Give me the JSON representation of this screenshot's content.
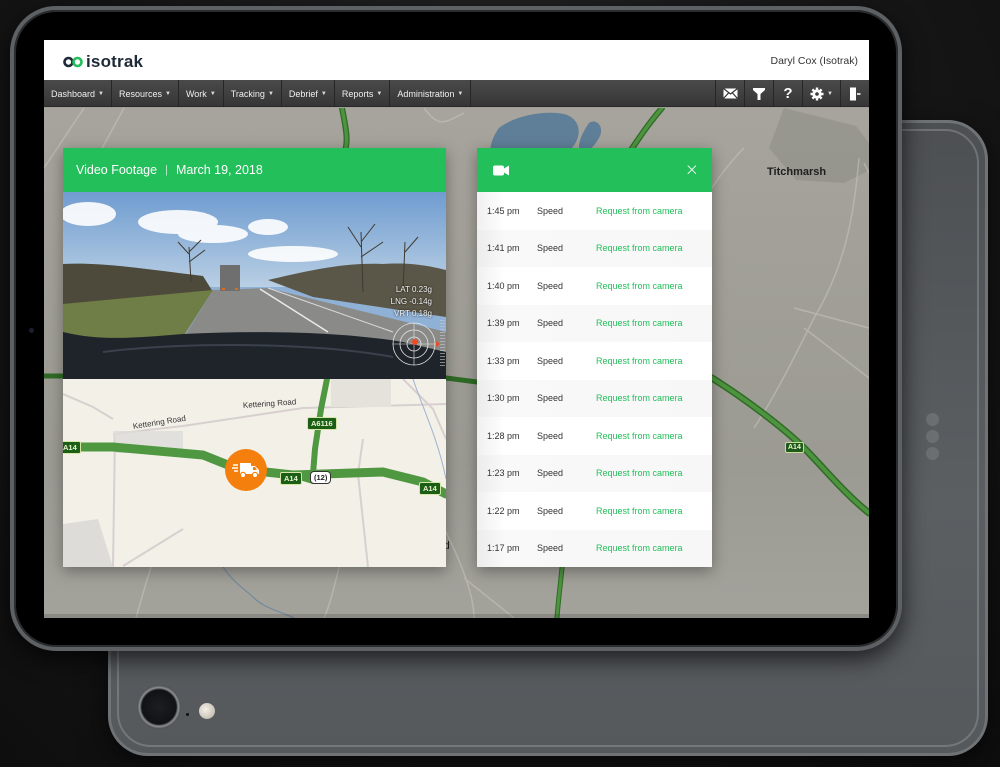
{
  "app": {
    "brand": "isotrak",
    "user": "Daryl Cox (Isotrak)",
    "colors": {
      "accent": "#22bf5a",
      "marker": "#f57f0c",
      "navbar": "#3c3c3c",
      "road": "#4f8f3a"
    }
  },
  "navbar": {
    "items": [
      {
        "label": "Dashboard"
      },
      {
        "label": "Resources"
      },
      {
        "label": "Work"
      },
      {
        "label": "Tracking"
      },
      {
        "label": "Debrief"
      },
      {
        "label": "Reports"
      },
      {
        "label": "Administration"
      }
    ],
    "icons": [
      "mail-icon",
      "filter-icon",
      "help-icon",
      "settings-icon",
      "logout-icon"
    ]
  },
  "map": {
    "town_label": "Titchmarsh",
    "road_shield": "A14",
    "partial_label": "rd"
  },
  "video_panel": {
    "title": "Video Footage",
    "date": "March 19, 2018",
    "gforce": {
      "lat": "LAT 0.23g",
      "lng": "LNG -0.14g",
      "vrt": "VRT 0.18g"
    },
    "mini_map": {
      "road_labels": [
        "Kettering Road",
        "Kettering Road"
      ],
      "shields": [
        "A14",
        "A6116",
        "A14",
        "(12)",
        "A14"
      ]
    }
  },
  "events_panel": {
    "header_icon": "video-camera-icon",
    "close_label": "×",
    "events": [
      {
        "time": "1:45 pm",
        "type": "Speed",
        "action": "Request from camera"
      },
      {
        "time": "1:41 pm",
        "type": "Speed",
        "action": "Request from camera"
      },
      {
        "time": "1:40 pm",
        "type": "Speed",
        "action": "Request from camera"
      },
      {
        "time": "1:39 pm",
        "type": "Speed",
        "action": "Request from camera"
      },
      {
        "time": "1:33 pm",
        "type": "Speed",
        "action": "Request from camera"
      },
      {
        "time": "1:30 pm",
        "type": "Speed",
        "action": "Request from camera"
      },
      {
        "time": "1:28 pm",
        "type": "Speed",
        "action": "Request from camera"
      },
      {
        "time": "1:23 pm",
        "type": "Speed",
        "action": "Request from camera"
      },
      {
        "time": "1:22 pm",
        "type": "Speed",
        "action": "Request from camera"
      },
      {
        "time": "1:17 pm",
        "type": "Speed",
        "action": "Request from camera"
      }
    ]
  }
}
